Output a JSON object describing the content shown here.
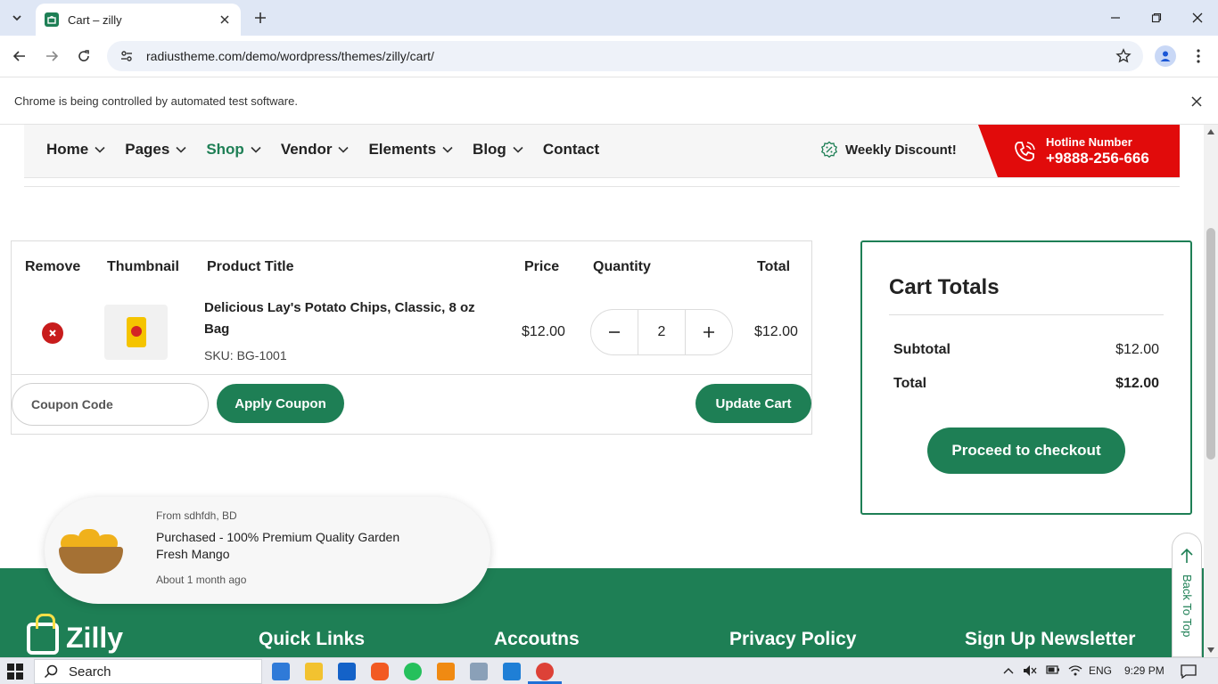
{
  "browser": {
    "tab_title": "Cart – zilly",
    "url": "radiustheme.com/demo/wordpress/themes/zilly/cart/",
    "infobar_text": "Chrome is being controlled by automated test software."
  },
  "nav": {
    "items": [
      {
        "label": "Home",
        "dropdown": true
      },
      {
        "label": "Pages",
        "dropdown": true
      },
      {
        "label": "Shop",
        "dropdown": true
      },
      {
        "label": "Vendor",
        "dropdown": true
      },
      {
        "label": "Elements",
        "dropdown": true
      },
      {
        "label": "Blog",
        "dropdown": true
      },
      {
        "label": "Contact",
        "dropdown": false
      }
    ],
    "active": "Shop",
    "weekly_discount": "Weekly Discount!",
    "hotline_label": "Hotline Number",
    "hotline_number": "+9888-256-666"
  },
  "cart": {
    "headers": {
      "remove": "Remove",
      "thumbnail": "Thumbnail",
      "title": "Product Title",
      "price": "Price",
      "quantity": "Quantity",
      "total": "Total"
    },
    "items": [
      {
        "title": "Delicious Lay's Potato Chips, Classic, 8 oz Bag",
        "sku": "SKU: BG-1001",
        "price": "$12.00",
        "quantity": "2",
        "total": "$12.00"
      }
    ],
    "coupon_placeholder": "Coupon Code",
    "apply_coupon": "Apply Coupon",
    "update_cart": "Update Cart"
  },
  "totals": {
    "title": "Cart Totals",
    "subtotal_label": "Subtotal",
    "subtotal_value": "$12.00",
    "total_label": "Total",
    "total_value": "$12.00",
    "checkout": "Proceed to checkout"
  },
  "popup": {
    "from": "From sdhfdh, BD",
    "message": "Purchased - 100% Premium Quality Garden Fresh Mango",
    "time": "About 1 month ago"
  },
  "back_to_top": "Back To Top",
  "footer": {
    "logo_text": "Zilly",
    "headings": [
      "Quick Links",
      "Accoutns",
      "Privacy Policy",
      "Sign Up Newsletter"
    ]
  },
  "taskbar": {
    "search_label": "Search",
    "lang": "ENG",
    "time": "9:29 PM"
  },
  "colors": {
    "brand_green": "#1e7f55",
    "hotline_red": "#e10b0b",
    "remove_red": "#c81c1c"
  }
}
